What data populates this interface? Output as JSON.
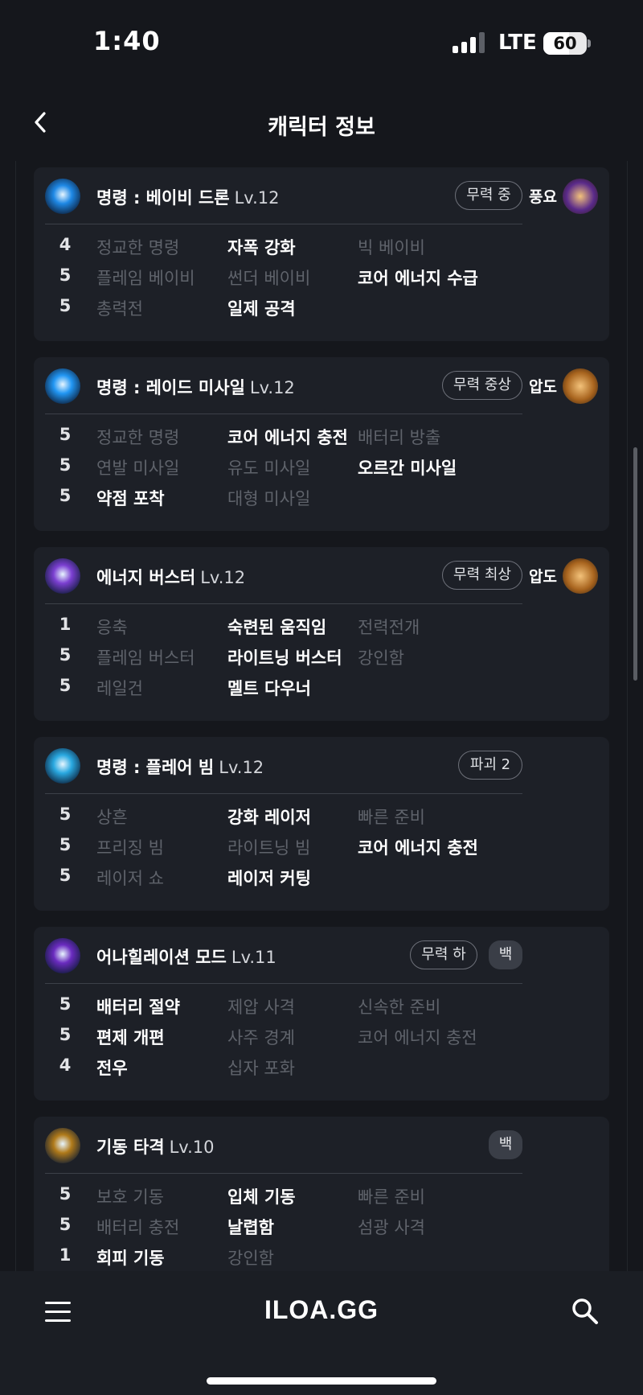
{
  "status": {
    "time": "1:40",
    "network": "LTE",
    "battery": "60",
    "battery_level": 0.6
  },
  "header": {
    "title": "캐릭터 정보"
  },
  "cards": [
    {
      "name": "명령 : 베이비 드론",
      "level": "Lv.12",
      "pill": "무력 중",
      "badge": "",
      "rune": "풍요",
      "rune_color": "#5a2a8a",
      "icon_color": "#1e88e5",
      "rows": [
        {
          "num": "4",
          "tripods": [
            {
              "t": "정교한 명령",
              "on": false
            },
            {
              "t": "자폭 강화",
              "on": true
            },
            {
              "t": "빅 베이비",
              "on": false
            }
          ]
        },
        {
          "num": "5",
          "tripods": [
            {
              "t": "플레임 베이비",
              "on": false
            },
            {
              "t": "썬더 베이비",
              "on": false
            },
            {
              "t": "코어 에너지 수급",
              "on": true
            }
          ]
        },
        {
          "num": "5",
          "tripods": [
            {
              "t": "총력전",
              "on": false
            },
            {
              "t": "일제 공격",
              "on": true
            },
            {
              "t": "",
              "on": false
            }
          ]
        }
      ]
    },
    {
      "name": "명령 : 레이드 미사일",
      "level": "Lv.12",
      "pill": "무력 중상",
      "badge": "",
      "rune": "압도",
      "rune_color": "#a8641e",
      "icon_color": "#2196f3",
      "rows": [
        {
          "num": "5",
          "tripods": [
            {
              "t": "정교한 명령",
              "on": false
            },
            {
              "t": "코어 에너지 충전",
              "on": true
            },
            {
              "t": "배터리 방출",
              "on": false
            }
          ]
        },
        {
          "num": "5",
          "tripods": [
            {
              "t": "연발 미사일",
              "on": false
            },
            {
              "t": "유도 미사일",
              "on": false
            },
            {
              "t": "오르간 미사일",
              "on": true
            }
          ]
        },
        {
          "num": "5",
          "tripods": [
            {
              "t": "약점 포착",
              "on": true
            },
            {
              "t": "대형 미사일",
              "on": false
            },
            {
              "t": "",
              "on": false
            }
          ]
        }
      ]
    },
    {
      "name": "에너지 버스터",
      "level": "Lv.12",
      "pill": "무력 최상",
      "badge": "",
      "rune": "압도",
      "rune_color": "#a8641e",
      "icon_color": "#7b3fd1",
      "rows": [
        {
          "num": "1",
          "tripods": [
            {
              "t": "응축",
              "on": false
            },
            {
              "t": "숙련된 움직임",
              "on": true
            },
            {
              "t": "전력전개",
              "on": false
            }
          ]
        },
        {
          "num": "5",
          "tripods": [
            {
              "t": "플레임 버스터",
              "on": false
            },
            {
              "t": "라이트닝 버스터",
              "on": true
            },
            {
              "t": "강인함",
              "on": false
            }
          ]
        },
        {
          "num": "5",
          "tripods": [
            {
              "t": "레일건",
              "on": false
            },
            {
              "t": "멜트 다우너",
              "on": true
            },
            {
              "t": "",
              "on": false
            }
          ]
        }
      ]
    },
    {
      "name": "명령 : 플레어 빔",
      "level": "Lv.12",
      "pill": "파괴 2",
      "badge": "",
      "rune": "",
      "rune_color": "",
      "icon_color": "#29a8e0",
      "rows": [
        {
          "num": "5",
          "tripods": [
            {
              "t": "상흔",
              "on": false
            },
            {
              "t": "강화 레이저",
              "on": true
            },
            {
              "t": "빠른 준비",
              "on": false
            }
          ]
        },
        {
          "num": "5",
          "tripods": [
            {
              "t": "프리징 빔",
              "on": false
            },
            {
              "t": "라이트닝 빔",
              "on": false
            },
            {
              "t": "코어 에너지 충전",
              "on": true
            }
          ]
        },
        {
          "num": "5",
          "tripods": [
            {
              "t": "레이저 쇼",
              "on": false
            },
            {
              "t": "레이저 커팅",
              "on": true
            },
            {
              "t": "",
              "on": false
            }
          ]
        }
      ]
    },
    {
      "name": "어나힐레이션 모드",
      "level": "Lv.11",
      "pill": "무력 하",
      "badge": "백",
      "rune": "",
      "rune_color": "",
      "icon_color": "#6a2bbf",
      "rows": [
        {
          "num": "5",
          "tripods": [
            {
              "t": "배터리 절약",
              "on": true
            },
            {
              "t": "제압 사격",
              "on": false
            },
            {
              "t": "신속한 준비",
              "on": false
            }
          ]
        },
        {
          "num": "5",
          "tripods": [
            {
              "t": "편제 개편",
              "on": true
            },
            {
              "t": "사주 경계",
              "on": false
            },
            {
              "t": "코어 에너지 충전",
              "on": false
            }
          ]
        },
        {
          "num": "4",
          "tripods": [
            {
              "t": "전우",
              "on": true
            },
            {
              "t": "십자 포화",
              "on": false
            },
            {
              "t": "",
              "on": false
            }
          ]
        }
      ]
    },
    {
      "name": "기동 타격",
      "level": "Lv.10",
      "pill": "",
      "badge": "백",
      "rune": "",
      "rune_color": "",
      "icon_color": "#b07a1a",
      "rows": [
        {
          "num": "5",
          "tripods": [
            {
              "t": "보호 기동",
              "on": false
            },
            {
              "t": "입체 기동",
              "on": true
            },
            {
              "t": "빠른 준비",
              "on": false
            }
          ]
        },
        {
          "num": "5",
          "tripods": [
            {
              "t": "배터리 충전",
              "on": false
            },
            {
              "t": "날렵함",
              "on": true
            },
            {
              "t": "섬광 사격",
              "on": false
            }
          ]
        },
        {
          "num": "1",
          "tripods": [
            {
              "t": "회피 기동",
              "on": true
            },
            {
              "t": "강인함",
              "on": false
            },
            {
              "t": "",
              "on": false
            }
          ]
        }
      ]
    }
  ],
  "bottom": {
    "logo": "ILOA.GG"
  }
}
